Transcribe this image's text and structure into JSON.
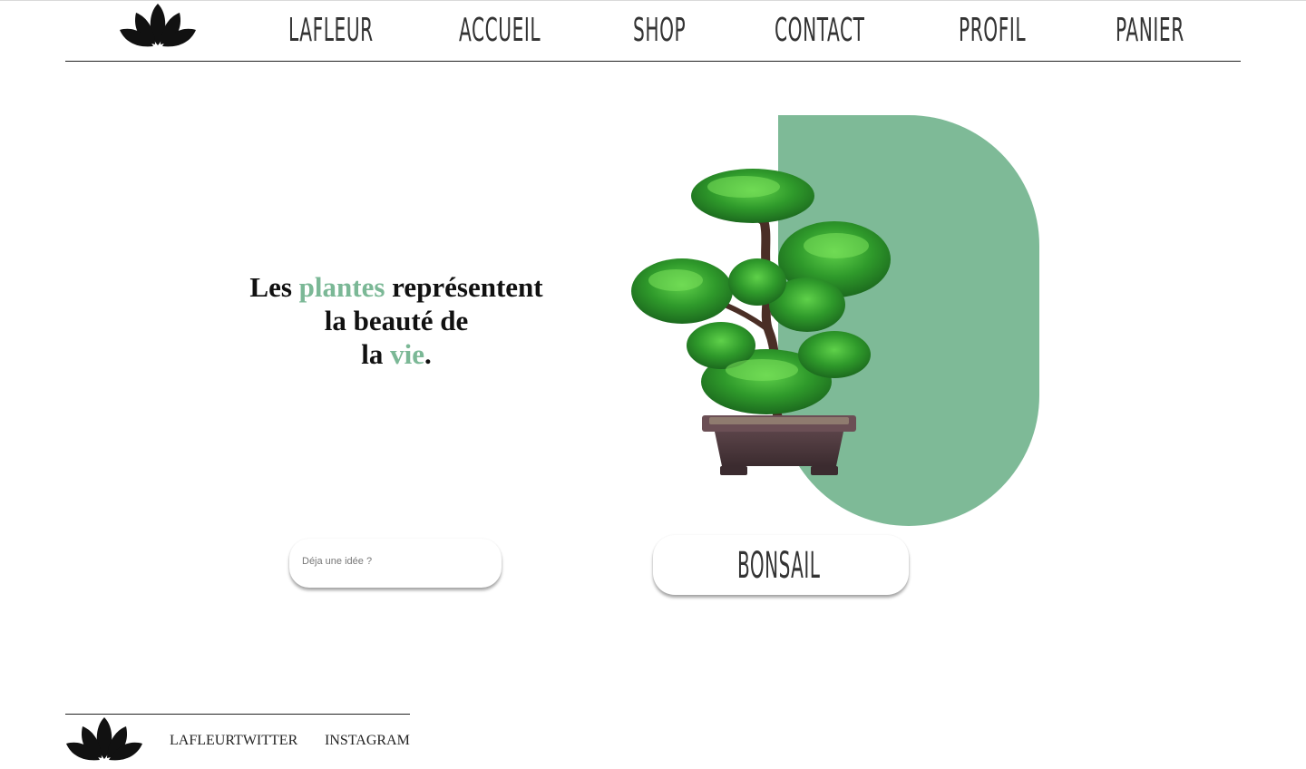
{
  "header": {
    "logo": "lotus-icon",
    "nav": [
      {
        "label": "LAFLEUR"
      },
      {
        "label": "ACCUEIL"
      },
      {
        "label": "SHOP"
      },
      {
        "label": "CONTACT"
      },
      {
        "label": "PROFIL"
      },
      {
        "label": "PANIER"
      }
    ]
  },
  "hero": {
    "headline": {
      "line1_before": "Les ",
      "line1_accent": "plantes",
      "line1_after": " représentent",
      "line2": "la beauté de",
      "line3_before": "la ",
      "line3_accent": "vie",
      "line3_after": "."
    },
    "image": "bonsai-tree",
    "search_placeholder": "Déja une idée ?",
    "product_button": "BONSAIL"
  },
  "footer": {
    "logo": "lotus-icon",
    "links": [
      "LAFLEURTWITTER",
      "INSTAGRAM"
    ]
  },
  "colors": {
    "accent": "#7bb896",
    "shape": "#7eba97",
    "text": "#111111"
  }
}
